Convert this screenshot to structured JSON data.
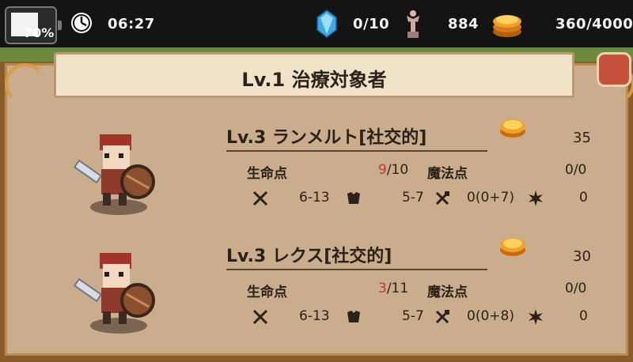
{
  "status_bar": {
    "battery": "70%",
    "time": "06:27",
    "gems": "0/10",
    "statues": "884",
    "gold": "360/4000"
  },
  "header": {
    "title": "Lv.1 治療対象者"
  },
  "colors": {
    "topbar": "#141414",
    "parchment": "#c9ad8c",
    "scroll": "#efe3c8",
    "frame_gold": "#d79b47",
    "hp_current": "#c03a2b"
  },
  "patients": [
    {
      "name": "Lv.3 ランメルト[社交的]",
      "cost": "35",
      "hp_label": "生命点",
      "hp_current": "9",
      "hp_max": "/10",
      "mp_label": "魔法点",
      "mp": "0/0",
      "attack": "6-13",
      "defense": "5-7",
      "repair": "0(0+7)",
      "special": "0"
    },
    {
      "name": "Lv.3 レクス[社交的]",
      "cost": "30",
      "hp_label": "生命点",
      "hp_current": "3",
      "hp_max": "/11",
      "mp_label": "魔法点",
      "mp": "0/0",
      "attack": "6-13",
      "defense": "5-7",
      "repair": "0(0+8)",
      "special": "0"
    }
  ]
}
